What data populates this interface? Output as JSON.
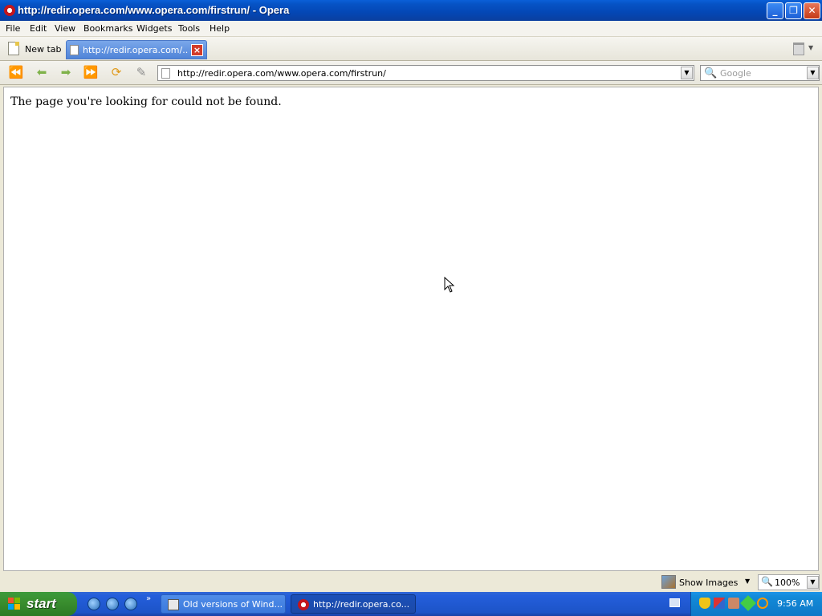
{
  "window": {
    "title": "http://redir.opera.com/www.opera.com/firstrun/ - Opera",
    "minimize_label": "_",
    "restore_label": "❐",
    "close_label": "✕"
  },
  "menu": {
    "items": [
      "File",
      "Edit",
      "View",
      "Bookmarks",
      "Widgets",
      "Tools",
      "Help"
    ]
  },
  "tabs": {
    "new_tab_label": "New tab",
    "active_tab_label": "http://redir.opera.com/...",
    "close_tab_label": "×"
  },
  "address_bar": {
    "url": "http://redir.opera.com/www.opera.com/firstrun/"
  },
  "search": {
    "placeholder": "Google"
  },
  "content": {
    "message": "The page you're looking for could not be found."
  },
  "statusbar": {
    "show_images_label": "Show Images",
    "zoom": "100%"
  },
  "taskbar": {
    "start_label": "start",
    "quick_launch_more": "»",
    "tasks": [
      {
        "label": "Old versions of Wind...",
        "active": false
      },
      {
        "label": "http://redir.opera.co...",
        "active": true
      }
    ],
    "clock": "9:56 AM"
  },
  "icons": {
    "back_fast": "rewind-icon",
    "back": "back-arrow-icon",
    "forward": "forward-arrow-icon",
    "forward_fast": "fast-forward-icon",
    "reload": "reload-icon",
    "edit": "pencil-icon",
    "trash": "trash-icon",
    "search": "magnifier-icon"
  },
  "colors": {
    "titlebar": "#0553c4",
    "active_tab": "#5a8ddc",
    "taskbar": "#245edb",
    "start_button": "#3a8f2f",
    "tray": "#128ad8"
  }
}
